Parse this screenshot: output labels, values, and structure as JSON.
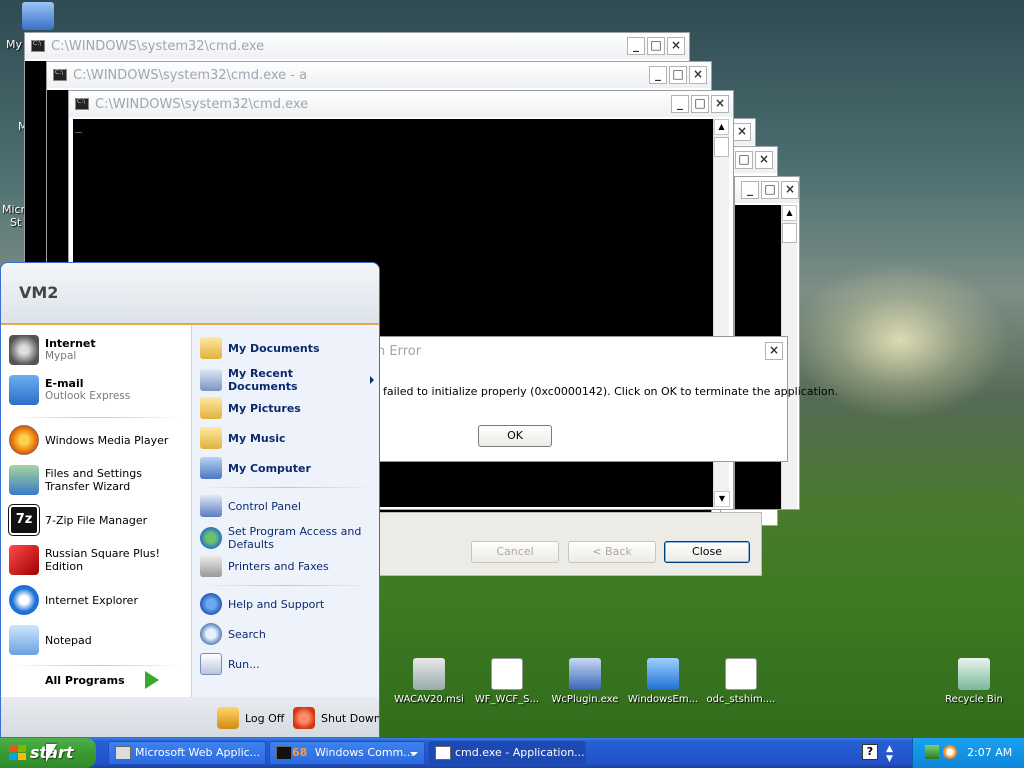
{
  "desktop": {
    "icons": [
      {
        "id": "wacav",
        "label": "WACAV20.msi"
      },
      {
        "id": "wfwcf",
        "label": "WF_WCF_S..."
      },
      {
        "id": "wcplugin",
        "label": "WcPlugin.exe"
      },
      {
        "id": "windowsem",
        "label": "WindowsEm..."
      },
      {
        "id": "odc",
        "label": "odc_stshim...."
      },
      {
        "id": "recycle",
        "label": "Recycle Bin"
      }
    ],
    "left_partial": {
      "my": "My",
      "m": "M",
      "micro": "Micro",
      "st": "St"
    }
  },
  "cmd_windows": [
    {
      "title": "C:\\WINDOWS\\system32\\cmd.exe"
    },
    {
      "title": "C:\\WINDOWS\\system32\\cmd.exe - a"
    },
    {
      "title": "C:\\WINDOWS\\system32\\cmd.exe"
    }
  ],
  "cmd_cursor": "_",
  "error_dialog": {
    "title": "n Error",
    "message": "failed to initialize properly (0xc0000142). Click on OK to terminate the application.",
    "ok_label": "OK",
    "close_glyph": "×"
  },
  "wizard_buttons": {
    "cancel": "Cancel",
    "back": "< Back",
    "close": "Close"
  },
  "titlebar_glyphs": {
    "min": "_",
    "max": "□",
    "close": "×"
  },
  "start_menu": {
    "user": "VM2",
    "pinned": [
      {
        "name": "Internet",
        "sub": "Mypal"
      },
      {
        "name": "E-mail",
        "sub": "Outlook Express"
      }
    ],
    "recent": [
      {
        "name": "Windows Media Player"
      },
      {
        "name": "Files and Settings Transfer Wizard"
      },
      {
        "name": "7-Zip File Manager"
      },
      {
        "name": "Russian Square Plus! Edition"
      },
      {
        "name": "Internet Explorer"
      },
      {
        "name": "Notepad"
      }
    ],
    "all_programs": "All Programs",
    "right": [
      {
        "name": "My Documents"
      },
      {
        "name": "My Recent Documents"
      },
      {
        "name": "My Pictures"
      },
      {
        "name": "My Music"
      },
      {
        "name": "My Computer"
      },
      {
        "name": "Control Panel"
      },
      {
        "name": "Set Program Access and Defaults"
      },
      {
        "name": "Printers and Faxes"
      },
      {
        "name": "Help and Support"
      },
      {
        "name": "Search"
      },
      {
        "name": "Run..."
      }
    ],
    "log_off": "Log Off",
    "shut_down": "Shut Down"
  },
  "taskbar": {
    "start": "start",
    "tasks": [
      {
        "label": "Microsoft Web Applic..."
      },
      {
        "label": "Windows Comm...",
        "count": "68"
      },
      {
        "label": "cmd.exe - Application..."
      }
    ],
    "clock": "2:07 AM",
    "help_glyph": "?"
  },
  "colors": {
    "xp_blue": "#2352c8",
    "start_green": "#3a9a35",
    "cmd_black": "#000000"
  }
}
